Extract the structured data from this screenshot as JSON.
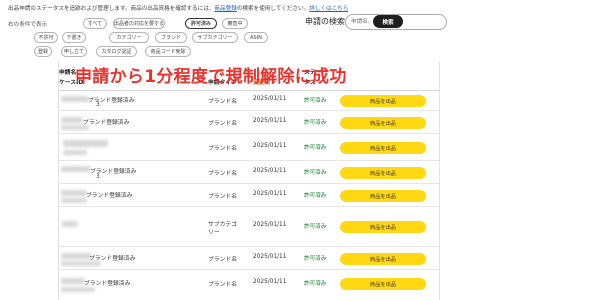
{
  "intro": {
    "prefix": "出品申請のステータスを追跡および管理します。商品の出品資格を確認するには、",
    "link_text": "商品登録",
    "suffix": "の検索を使用してください。",
    "details_link": "詳しくはこちら"
  },
  "filters": {
    "label": "右の条件で表示",
    "chips": [
      {
        "label": "すべて",
        "active": false
      },
      {
        "label": "出品者の対応を要する",
        "active": false
      },
      {
        "label": "許可済み",
        "active": true
      },
      {
        "label": "審査中",
        "active": false
      },
      {
        "label": "不許可",
        "active": false
      },
      {
        "label": "下書き",
        "active": false
      },
      {
        "label": "カテゴリー",
        "active": false
      },
      {
        "label": "ブランド",
        "active": false
      },
      {
        "label": "サブカテゴリー",
        "active": false
      },
      {
        "label": "ASIN",
        "active": false
      },
      {
        "label": "登録",
        "active": false
      },
      {
        "label": "申し立て",
        "active": false
      },
      {
        "label": "カタログ認証",
        "active": false
      },
      {
        "label": "商品コード免除",
        "active": false
      }
    ]
  },
  "search": {
    "label": "申請の検索",
    "placeholder": "申請名、タイプ、",
    "button": "検索"
  },
  "overlay_caption": "申請から1分程度で規制解除に成功",
  "table": {
    "headers": {
      "name": "申請名",
      "case_id": "ケースID",
      "type": "申請タイプ",
      "changed": "変更日",
      "status_top": "ステー",
      "status_bottom": "タス"
    },
    "rows": [
      {
        "name": "ブランド登録済み",
        "suffix": "3",
        "type": "ブランド名",
        "date": "2025/01/11",
        "status": "許可済み",
        "action": "商品を出品"
      },
      {
        "name": "ブランド登録済み",
        "suffix": "",
        "type": "ブランド名",
        "date": "2025/01/11",
        "status": "許可済み",
        "action": "商品を出品"
      },
      {
        "name": "",
        "suffix": "",
        "type": "ブランド名",
        "date": "2025/01/11",
        "status": "許可済み",
        "action": "商品を出品"
      },
      {
        "name": "ブランド登録済み",
        "suffix": "3",
        "type": "ブランド名",
        "date": "2025/01/11",
        "status": "許可済み",
        "action": "商品を出品"
      },
      {
        "name": "ブランド登録済み",
        "suffix": "",
        "type": "ブランド名",
        "date": "2025/01/11",
        "status": "許可済み",
        "action": "商品を出品"
      },
      {
        "name": "",
        "suffix": "",
        "type": "サブカテゴリー",
        "date": "2025/01/11",
        "status": "許可済み",
        "action": "商品を出品"
      },
      {
        "name": "ブランド登録済み",
        "suffix": "",
        "type": "ブランド名",
        "date": "2025/01/11",
        "status": "許可済み",
        "action": "商品を出品"
      },
      {
        "name": "ブランド登録済み",
        "suffix": "",
        "type": "ブランド名",
        "date": "2025/01/11",
        "status": "許可済み",
        "action": "商品を出品"
      }
    ]
  },
  "colors": {
    "accent_sort": "#d85e00",
    "status_green": "#0b7a2a",
    "sell_button": "#ffd814",
    "overlay_red": "#e8332e",
    "link_blue": "#1a66b8"
  }
}
